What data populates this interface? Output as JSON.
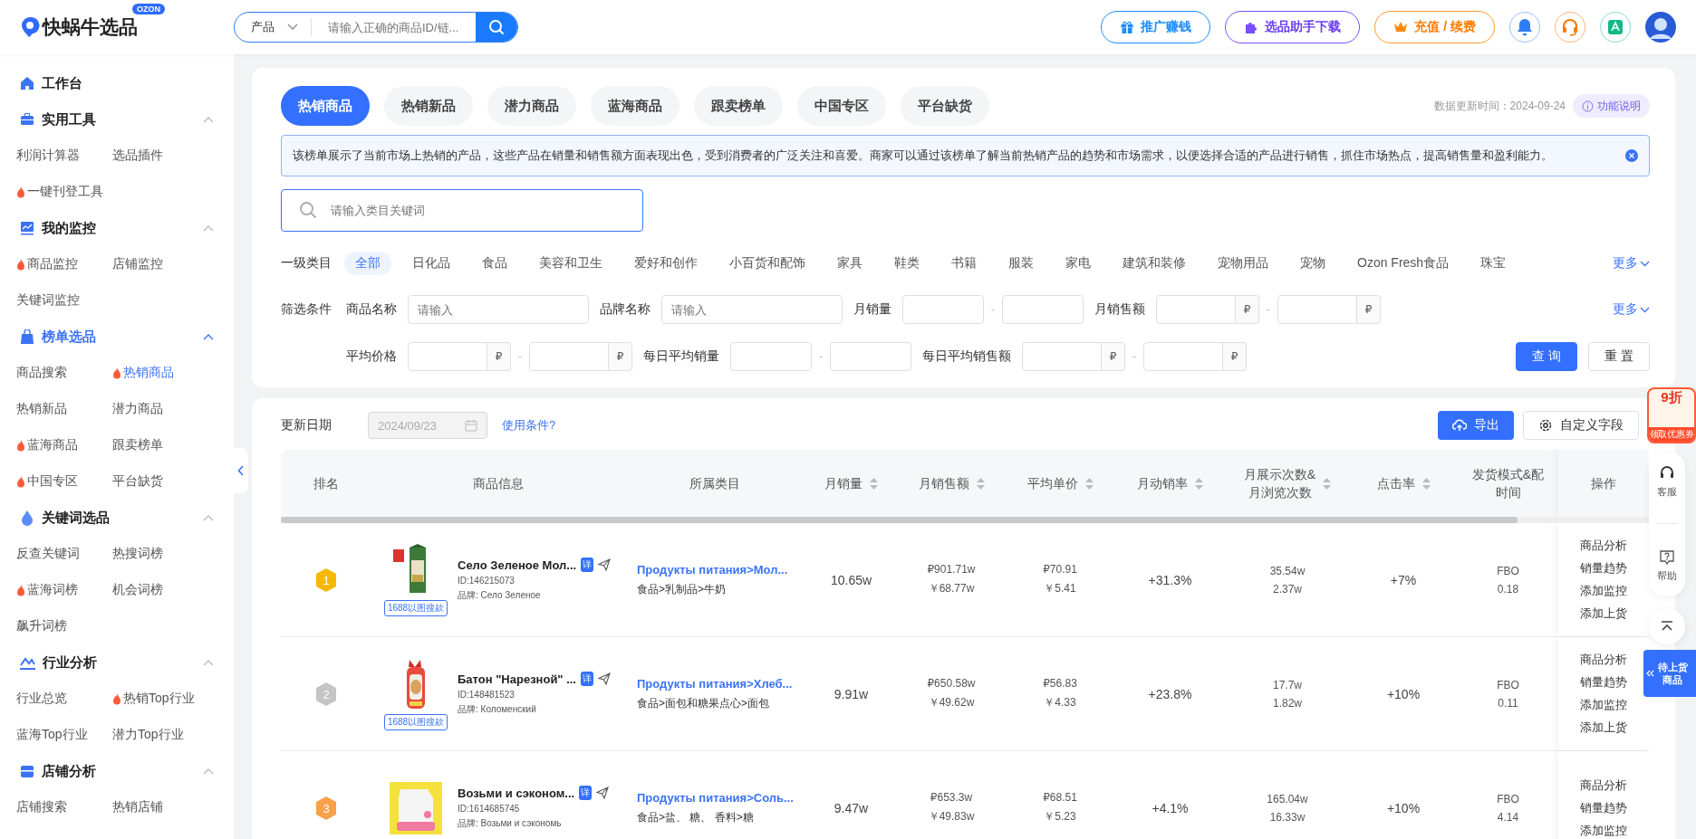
{
  "header": {
    "logo": "快蜗牛选品",
    "logo_badge": "OZON",
    "search": {
      "scope": "产品",
      "placeholder": "请输入正确的商品ID/链..."
    },
    "buttons": [
      {
        "label": "推广赚钱",
        "kind": "promote"
      },
      {
        "label": "选品助手下载",
        "kind": "download"
      },
      {
        "label": "充值 / 续费",
        "kind": "recharge"
      }
    ]
  },
  "sidebar": {
    "home": "工作台",
    "sections": [
      {
        "title": "实用工具",
        "kind": "toolbox",
        "active": false,
        "expanded": true,
        "items": [
          {
            "label": "利润计算器",
            "hot": false,
            "selected": false
          },
          {
            "label": "选品插件",
            "hot": false,
            "selected": false
          },
          {
            "label": "一键刊登工具",
            "hot": true,
            "selected": false
          }
        ]
      },
      {
        "title": "我的监控",
        "kind": "monitor",
        "active": false,
        "expanded": true,
        "items": [
          {
            "label": "商品监控",
            "hot": true,
            "selected": false
          },
          {
            "label": "店铺监控",
            "hot": false,
            "selected": false
          },
          {
            "label": "关键词监控",
            "hot": false,
            "selected": false
          }
        ]
      },
      {
        "title": "榜单选品",
        "kind": "bag",
        "active": true,
        "expanded": true,
        "items": [
          {
            "label": "商品搜索",
            "hot": false,
            "selected": false
          },
          {
            "label": "热销商品",
            "hot": true,
            "selected": true
          },
          {
            "label": "热销新品",
            "hot": false,
            "selected": false
          },
          {
            "label": "潜力商品",
            "hot": false,
            "selected": false
          },
          {
            "label": "蓝海商品",
            "hot": true,
            "selected": false
          },
          {
            "label": "跟卖榜单",
            "hot": false,
            "selected": false
          },
          {
            "label": "中国专区",
            "hot": true,
            "selected": false
          },
          {
            "label": "平台缺货",
            "hot": false,
            "selected": false
          }
        ]
      },
      {
        "title": "关键词选品",
        "kind": "drop",
        "active": false,
        "expanded": true,
        "items": [
          {
            "label": "反查关键词",
            "hot": false,
            "selected": false
          },
          {
            "label": "热搜词榜",
            "hot": false,
            "selected": false
          },
          {
            "label": "蓝海词榜",
            "hot": true,
            "selected": false
          },
          {
            "label": "机会词榜",
            "hot": false,
            "selected": false
          },
          {
            "label": "飙升词榜",
            "hot": false,
            "selected": false
          }
        ]
      },
      {
        "title": "行业分析",
        "kind": "chart",
        "active": false,
        "expanded": true,
        "items": [
          {
            "label": "行业总览",
            "hot": false,
            "selected": false
          },
          {
            "label": "热销Top行业",
            "hot": true,
            "selected": false
          },
          {
            "label": "蓝海Top行业",
            "hot": false,
            "selected": false
          },
          {
            "label": "潜力Top行业",
            "hot": false,
            "selected": false
          }
        ]
      },
      {
        "title": "店铺分析",
        "kind": "store",
        "active": false,
        "expanded": true,
        "items": [
          {
            "label": "店铺搜索",
            "hot": false,
            "selected": false
          },
          {
            "label": "热销店铺",
            "hot": false,
            "selected": false
          }
        ]
      }
    ]
  },
  "tabs": [
    {
      "label": "热销商品",
      "selected": true
    },
    {
      "label": "热销新品",
      "selected": false
    },
    {
      "label": "潜力商品",
      "selected": false
    },
    {
      "label": "蓝海商品",
      "selected": false
    },
    {
      "label": "跟卖榜单",
      "selected": false
    },
    {
      "label": "中国专区",
      "selected": false
    },
    {
      "label": "平台缺货",
      "selected": false
    }
  ],
  "update_time": "数据更新时间：2024-09-24",
  "help_button": "功能说明",
  "banner": "该榜单展示了当前市场上热销的产品，这些产品在销量和销售额方面表现出色，受到消费者的广泛关注和喜爱。商家可以通过该榜单了解当前热销产品的趋势和市场需求，以便选择合适的产品进行销售，抓住市场热点，提高销售量和盈利能力。",
  "category_search": {
    "placeholder": "请输入类目关键词"
  },
  "categories": {
    "label": "一级类目",
    "more": "更多",
    "items": [
      {
        "label": "全部",
        "selected": true
      },
      {
        "label": "日化品",
        "selected": false
      },
      {
        "label": "食品",
        "selected": false
      },
      {
        "label": "美容和卫生",
        "selected": false
      },
      {
        "label": "爱好和创作",
        "selected": false
      },
      {
        "label": "小百货和配饰",
        "selected": false
      },
      {
        "label": "家具",
        "selected": false
      },
      {
        "label": "鞋类",
        "selected": false
      },
      {
        "label": "书籍",
        "selected": false
      },
      {
        "label": "服装",
        "selected": false
      },
      {
        "label": "家电",
        "selected": false
      },
      {
        "label": "建筑和装修",
        "selected": false
      },
      {
        "label": "宠物用品",
        "selected": false
      },
      {
        "label": "宠物",
        "selected": false
      },
      {
        "label": "Ozon Fresh食品",
        "selected": false
      },
      {
        "label": "珠宝",
        "selected": false
      }
    ]
  },
  "filters": {
    "label": "筛选条件",
    "more": "更多",
    "rows": [
      [
        {
          "label": "商品名称",
          "kind": "text",
          "placeholder": "请输入"
        },
        {
          "label": "品牌名称",
          "kind": "text",
          "placeholder": "请输入"
        },
        {
          "label": "月销量",
          "kind": "range",
          "separator": "-"
        },
        {
          "label": "月销售额",
          "kind": "range",
          "unit": "₽",
          "separator": "-"
        }
      ],
      [
        {
          "label": "平均价格",
          "kind": "range",
          "unit": "₽",
          "separator": "-"
        },
        {
          "label": "每日平均销量",
          "kind": "range",
          "separator": "-"
        },
        {
          "label": "每日平均销售额",
          "kind": "range",
          "unit": "₽",
          "separator": "-"
        }
      ]
    ],
    "buttons": [
      {
        "label": "查 询",
        "kind": "primary"
      },
      {
        "label": "重 置",
        "kind": "plain"
      }
    ]
  },
  "toolbar": {
    "date_label": "更新日期",
    "date_value": "2024/09/23",
    "conditions_link": "使用条件?",
    "export": "导出",
    "customize": "自定义字段"
  },
  "table": {
    "columns": [
      {
        "label": "排名",
        "sortable": false
      },
      {
        "label": "商品信息",
        "sortable": false
      },
      {
        "label": "所属类目",
        "sortable": false
      },
      {
        "label": "月销量",
        "sortable": true
      },
      {
        "label": "月销售额",
        "sortable": true
      },
      {
        "label": "平均单价",
        "sortable": true
      },
      {
        "label": "月动销率",
        "sortable": true
      },
      {
        "label": "月展示次数&",
        "label2": "月浏览次数",
        "sortable": true
      },
      {
        "label": "点击率",
        "sortable": true
      },
      {
        "label": "发货模式&配",
        "label2": "时间",
        "sortable": false
      },
      {
        "label": "操作",
        "sortable": false
      }
    ],
    "rows": [
      {
        "rank": "1",
        "color": "#f5b800",
        "title": "Село Зеленое Мол...",
        "tag": "详",
        "id": "ID:146215073",
        "brand": "品牌: Село Зеленое",
        "badge": "1688以图搜款",
        "category_link": "Продукты питания>Мол...",
        "category_path": "食品>乳制品>牛奶",
        "monthly_sales": "10.65w",
        "monthly_revenue": [
          "₽901.71w",
          "￥68.77w"
        ],
        "avg_price": [
          "₽70.91",
          "￥5.41"
        ],
        "turnover": "+31.3%",
        "impressions": [
          "35.54w",
          "2.37w"
        ],
        "ctr": "+7%",
        "shipping": [
          "FBO",
          "0.18"
        ],
        "actions": [
          "商品分析",
          "销量趋势",
          "添加监控",
          "添加上货"
        ]
      },
      {
        "rank": "2",
        "color": "#c4c4c4",
        "title": "Батон \"Нарезной\" ...",
        "tag": "详",
        "id": "ID:148481523",
        "brand": "品牌: Коломенский",
        "badge": "1688以图搜款",
        "category_link": "Продукты питания>Хлеб...",
        "category_path": "食品>面包和糖果点心>面包",
        "monthly_sales": "9.91w",
        "monthly_revenue": [
          "₽650.58w",
          "￥49.62w"
        ],
        "avg_price": [
          "₽56.83",
          "￥4.33"
        ],
        "turnover": "+23.8%",
        "impressions": [
          "17.7w",
          "1.82w"
        ],
        "ctr": "+10%",
        "shipping": [
          "FBO",
          "0.11"
        ],
        "actions": [
          "商品分析",
          "销量趋势",
          "添加监控",
          "添加上货"
        ]
      },
      {
        "rank": "3",
        "color": "#f7a14a",
        "title": "Возьми и сэконом...",
        "tag": "详",
        "id": "ID:1614685745",
        "brand": "品牌: Возьми и сэкономь",
        "category_link": "Продукты питания>Соль...",
        "category_path": "食品>盐、 糖、 香料>糖",
        "monthly_sales": "9.47w",
        "monthly_revenue": [
          "₽653.3w",
          "￥49.83w"
        ],
        "avg_price": [
          "₽68.51",
          "￥5.23"
        ],
        "turnover": "+4.1%",
        "impressions": [
          "165.04w",
          "16.33w"
        ],
        "ctr": "+10%",
        "shipping": [
          "FBO",
          "4.14"
        ],
        "actions": [
          "商品分析",
          "销量趋势",
          "添加监控"
        ]
      }
    ]
  },
  "floating": {
    "coupon": "9折",
    "coupon_caption": "领取优惠券",
    "service": "客服",
    "help": "帮助",
    "pending": "待上货商品"
  }
}
